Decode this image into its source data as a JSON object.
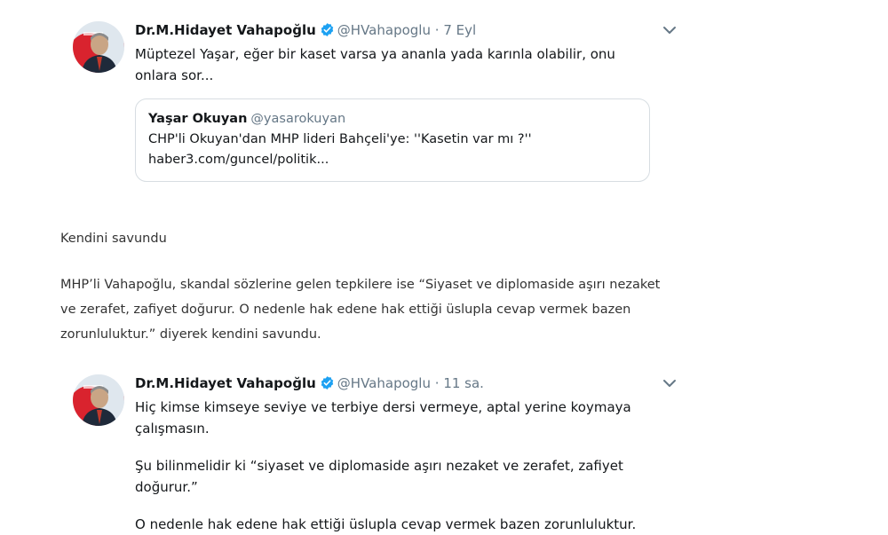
{
  "tweet1": {
    "name": "Dr.M.Hidayet Vahapoğlu",
    "handle": "@HVahapoglu",
    "dot": "·",
    "time": "7 Eyl",
    "text": "Müptezel Yaşar,  eğer bir kaset varsa ya ananla yada karınla olabilir, onu onlara sor...",
    "quote": {
      "name": "Yaşar Okuyan",
      "handle": "@yasarokuyan",
      "text": "CHP'li Okuyan'dan MHP lideri Bahçeli'ye: ''Kasetin var mı ?''",
      "link": "haber3.com/guncel/politik..."
    }
  },
  "article": {
    "heading": "Kendini savundu",
    "paragraph": "MHP’li Vahapoğlu, skandal sözlerine gelen tepkilere ise “Siyaset ve diplomaside aşırı nezaket ve zerafet, zafiyet doğurur. O nedenle hak edene hak ettiği üslupla cevap vermek bazen zorunluluktur.” diyerek kendini savundu."
  },
  "tweet2": {
    "name": "Dr.M.Hidayet Vahapoğlu",
    "handle": "@HVahapoglu",
    "dot": "·",
    "time": "11 sa.",
    "line1": "Hiç kimse kimseye seviye ve terbiye dersi vermeye, aptal yerine koymaya çalışmasın.",
    "line2": "Şu bilinmelidir ki “siyaset ve diplomaside aşırı nezaket ve zerafet, zafiyet doğurur.”",
    "line3": "O nedenle hak edene hak ettiği üslupla cevap vermek bazen zorunluluktur."
  },
  "colors": {
    "verified": "#1da1f2",
    "muted": "#657786",
    "border": "#d7dde2"
  },
  "icons": {
    "verified": "verified-badge-icon",
    "chevron": "chevron-down-icon"
  }
}
